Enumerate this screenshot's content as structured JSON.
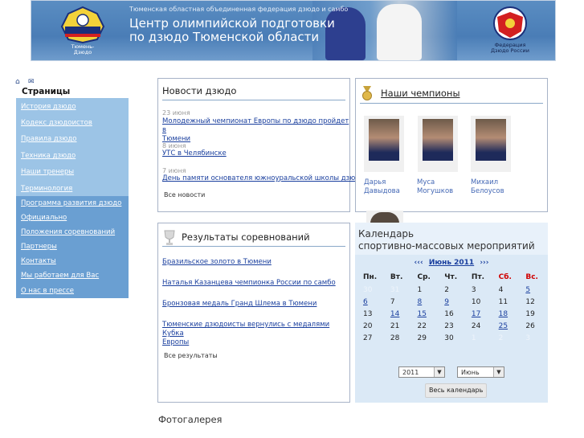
{
  "header": {
    "subtitle": "Тюменская областная объединенная федерация дзюдо и самбо",
    "title_line1": "Центр олимпийской подготовки",
    "title_line2": "по дзюдо Тюменской области",
    "logo_left_label": "Тюмень-\nДзюдо",
    "logo_right_label": "Федерация\nДзюдо России"
  },
  "sidebar": {
    "title": "Страницы",
    "items": [
      "История дзюдо",
      "Кодекс дзюдоистов",
      "Правила дзюдо",
      "Техника дзюдо",
      "Наши тренеры",
      "Терминология",
      "Программа развития дзюдо",
      "Официально",
      "Положения соревнований",
      "Партнеры",
      "Контакты",
      "Мы работаем для Вас",
      "О нас в прессе"
    ]
  },
  "news": {
    "title": "Новости дзюдо",
    "items": [
      {
        "date": "23 июня",
        "text_line1": "Молодежный чемпионат Европы по дзюдо пройдет в",
        "text_line2": "Тюмени"
      },
      {
        "date": "8 июня",
        "text_line1": "УТС в Челябинске",
        "text_line2": ""
      },
      {
        "date": "7 июня",
        "text_line1": "День памяти основателя южноуральской школы дзюдо",
        "text_line2": ""
      }
    ],
    "all_link": "Все новости"
  },
  "champions": {
    "title": "Наши чемпионы",
    "people": [
      {
        "first": "Дарья",
        "last": "Давыдова"
      },
      {
        "first": "Муса",
        "last": "Могушков"
      },
      {
        "first": "Михаил",
        "last": "Белоусов"
      }
    ]
  },
  "results": {
    "title": "Результаты соревнований",
    "items": [
      {
        "line1": "Бразильское золото в Тюмени",
        "line2": ""
      },
      {
        "line1": "Наталья Казанцева чемпионка России по самбо",
        "line2": ""
      },
      {
        "line1": "Бронзовая медаль Гранд Шлема в Тюмени",
        "line2": ""
      },
      {
        "line1": "Тюменские дзюдоисты вернулись с медалями Кубка",
        "line2": "Европы"
      }
    ],
    "all_link": "Все результаты"
  },
  "calendar": {
    "title_line1": "Календарь",
    "title_line2": "спортивно-массовых мероприятий",
    "prev": "‹‹‹",
    "month": "Июнь 2011",
    "next": "›››",
    "weekdays": [
      "Пн.",
      "Вт.",
      "Ср.",
      "Чт.",
      "Пт.",
      "Сб.",
      "Вс."
    ],
    "weekend_color": "#d00000",
    "weeks": [
      [
        {
          "d": "30",
          "t": "other"
        },
        {
          "d": "31",
          "t": "other"
        },
        {
          "d": "1",
          "t": "plain"
        },
        {
          "d": "2",
          "t": "plain"
        },
        {
          "d": "3",
          "t": "plain"
        },
        {
          "d": "4",
          "t": "plain"
        },
        {
          "d": "5",
          "t": "link"
        }
      ],
      [
        {
          "d": "6",
          "t": "link"
        },
        {
          "d": "7",
          "t": "plain"
        },
        {
          "d": "8",
          "t": "link"
        },
        {
          "d": "9",
          "t": "link"
        },
        {
          "d": "10",
          "t": "plain"
        },
        {
          "d": "11",
          "t": "plain"
        },
        {
          "d": "12",
          "t": "plain"
        }
      ],
      [
        {
          "d": "13",
          "t": "plain"
        },
        {
          "d": "14",
          "t": "link"
        },
        {
          "d": "15",
          "t": "link"
        },
        {
          "d": "16",
          "t": "plain"
        },
        {
          "d": "17",
          "t": "link"
        },
        {
          "d": "18",
          "t": "link"
        },
        {
          "d": "19",
          "t": "plain"
        }
      ],
      [
        {
          "d": "20",
          "t": "plain"
        },
        {
          "d": "21",
          "t": "plain"
        },
        {
          "d": "22",
          "t": "plain"
        },
        {
          "d": "23",
          "t": "plain"
        },
        {
          "d": "24",
          "t": "plain"
        },
        {
          "d": "25",
          "t": "link"
        },
        {
          "d": "26",
          "t": "plain"
        }
      ],
      [
        {
          "d": "27",
          "t": "plain"
        },
        {
          "d": "28",
          "t": "plain"
        },
        {
          "d": "29",
          "t": "plain"
        },
        {
          "d": "30",
          "t": "plain"
        },
        {
          "d": "1",
          "t": "other"
        },
        {
          "d": "2",
          "t": "other"
        },
        {
          "d": "3",
          "t": "other"
        }
      ]
    ],
    "year_select": "2011",
    "month_select": "Июнь",
    "button": "Весь календарь"
  },
  "gallery": {
    "title": "Фотогалерея"
  },
  "icons": {
    "home": "home-icon",
    "mail": "mail-icon",
    "medal": "medal-icon",
    "cup": "cup-icon"
  }
}
